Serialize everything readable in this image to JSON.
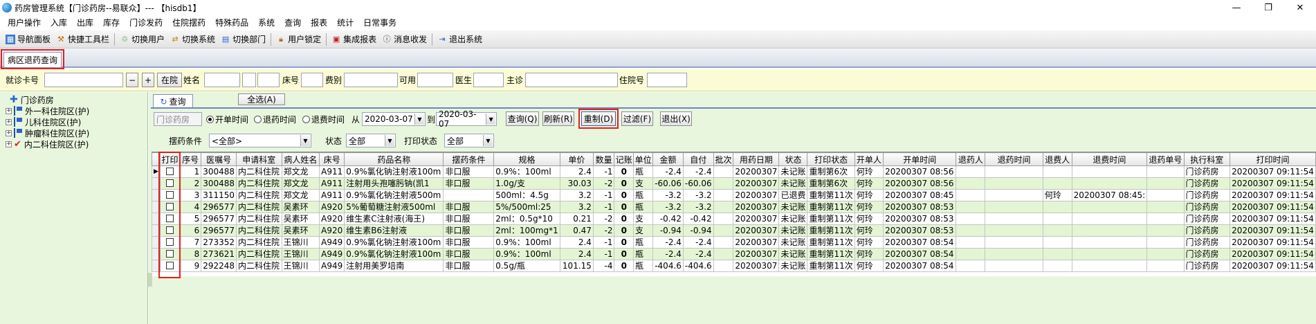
{
  "window": {
    "title": "药房管理系统【门诊药房--易联众】--- 【hisdb1】",
    "controls": [
      "—",
      "❐",
      "✕"
    ]
  },
  "menu": [
    "用户操作",
    "入库",
    "出库",
    "库存",
    "门诊发药",
    "住院摆药",
    "特殊药品",
    "系统",
    "查询",
    "报表",
    "统计",
    "日常事务"
  ],
  "toolbar": [
    {
      "label": "导航面板",
      "icon": "nav-panel-icon"
    },
    {
      "label": "快捷工具栏",
      "icon": "quick-toolbar-icon"
    },
    {
      "label": "切换用户",
      "icon": "switch-user-icon"
    },
    {
      "label": "切换系统",
      "icon": "switch-system-icon"
    },
    {
      "label": "切换部门",
      "icon": "switch-dept-icon"
    },
    {
      "label": "用户锁定",
      "icon": "user-lock-icon"
    },
    {
      "label": "集成报表",
      "icon": "report-icon"
    },
    {
      "label": "消息收发",
      "icon": "message-icon"
    },
    {
      "label": "退出系统",
      "icon": "exit-icon"
    }
  ],
  "tab": {
    "label": "病区退药查询"
  },
  "filter": {
    "card_label": "就诊卡号",
    "card_value": "",
    "minus": "−",
    "plus": "+",
    "status_btn": "在院",
    "name_label": "姓名",
    "bed_label": "床号",
    "fee_label": "费别",
    "usable_label": "可用",
    "doctor_label": "医生",
    "main_label": "主诊",
    "inpatient_label": "住院号"
  },
  "tree": [
    {
      "label": "门诊药房",
      "type": "root"
    },
    {
      "label": "外一科住院区(护)",
      "type": "ward"
    },
    {
      "label": "儿科住院区(护)",
      "type": "ward"
    },
    {
      "label": "肿瘤科住院区(护)",
      "type": "ward"
    },
    {
      "label": "内二科住院区(护)",
      "type": "checked"
    }
  ],
  "query": {
    "tab_label": "查询",
    "select_all": "全选(A)",
    "pharmacy_field": "门诊药房",
    "radio_open": "开单时间",
    "radio_return": "退药时间",
    "radio_refund": "退费时间",
    "from_label": "从",
    "from_date": "2020-03-07",
    "to_label": "到",
    "to_date": "2020-03-07",
    "btn_query": "查询(Q)",
    "btn_refresh": "刷新(R)",
    "btn_reprint": "重制(D)",
    "btn_filter": "过滤(F)",
    "btn_exit": "退出(X)",
    "cond_label": "摆药条件",
    "cond_value": "<全部>",
    "status_label": "状态",
    "status_value": "全部",
    "print_label": "打印状态",
    "print_value": "全部"
  },
  "table": {
    "columns": [
      "打印",
      "序号",
      "医嘱号",
      "申请科室",
      "病人姓名",
      "床号",
      "药品名称",
      "摆药条件",
      "规格",
      "单价",
      "数量",
      "记账",
      "单位",
      "金额",
      "自付",
      "批次",
      "用药日期",
      "状态",
      "打印状态",
      "开单人",
      "开单时间",
      "退药人",
      "退药时间",
      "退费人",
      "退费时间",
      "退药单号",
      "执行科室",
      "打印时间"
    ],
    "rows": [
      [
        "1",
        "300488",
        "内二科住院",
        "郑文龙",
        "A911",
        "0.9%氯化钠注射液100m",
        "非口服",
        "0.9%：100ml",
        "2.4",
        "-1",
        "0",
        "瓶",
        "-2.4",
        "-2.4",
        "",
        "20200307",
        "未记账",
        "重制第6次",
        "何玲",
        "20200307 08:56",
        "",
        "",
        "",
        "",
        "",
        "门诊药房",
        "20200307 09:11:54"
      ],
      [
        "2",
        "300488",
        "内二科住院",
        "郑文龙",
        "A911",
        "注射用头孢噻肟钠(凯1",
        "非口服",
        "1.0g/支",
        "30.03",
        "-2",
        "0",
        "支",
        "-60.06",
        "-60.06",
        "",
        "20200307",
        "未记账",
        "重制第6次",
        "何玲",
        "20200307 08:56",
        "",
        "",
        "",
        "",
        "",
        "门诊药房",
        "20200307 09:11:54"
      ],
      [
        "3",
        "311150",
        "内二科住院",
        "郑文龙",
        "A911",
        "0.9%氯化钠注射液500m",
        "",
        "500ml：4.5g",
        "3.2",
        "-1",
        "0",
        "瓶",
        "-3.2",
        "-3.2",
        "",
        "20200307",
        "已退费",
        "重制第11次",
        "何玲",
        "20200307 08:45",
        "",
        "",
        "何玲",
        "20200307 08:45:",
        "",
        "门诊药房",
        "20200307 09:11:54"
      ],
      [
        "4",
        "296577",
        "内二科住院",
        "吴素环",
        "A920",
        "5%葡萄糖注射液500ml",
        "非口服",
        "5%/500ml:25",
        "3.2",
        "-1",
        "0",
        "瓶",
        "-3.2",
        "-3.2",
        "",
        "20200307",
        "未记账",
        "重制第11次",
        "何玲",
        "20200307 08:53",
        "",
        "",
        "",
        "",
        "",
        "门诊药房",
        "20200307 09:11:54"
      ],
      [
        "5",
        "296577",
        "内二科住院",
        "吴素环",
        "A920",
        "维生素C注射液(海王)",
        "非口服",
        "2ml：0.5g*10",
        "0.21",
        "-2",
        "0",
        "支",
        "-0.42",
        "-0.42",
        "",
        "20200307",
        "未记账",
        "重制第11次",
        "何玲",
        "20200307 08:53",
        "",
        "",
        "",
        "",
        "",
        "门诊药房",
        "20200307 09:11:54"
      ],
      [
        "6",
        "296577",
        "内二科住院",
        "吴素环",
        "A920",
        "维生素B6注射液",
        "非口服",
        "2ml：100mg*1",
        "0.47",
        "-2",
        "0",
        "支",
        "-0.94",
        "-0.94",
        "",
        "20200307",
        "未记账",
        "重制第11次",
        "何玲",
        "20200307 08:53",
        "",
        "",
        "",
        "",
        "",
        "门诊药房",
        "20200307 09:11:54"
      ],
      [
        "7",
        "273352",
        "内二科住院",
        "王锦川",
        "A949",
        "0.9%氯化钠注射液100m",
        "非口服",
        "0.9%：100ml",
        "2.4",
        "-1",
        "0",
        "瓶",
        "-2.4",
        "-2.4",
        "",
        "20200307",
        "未记账",
        "重制第11次",
        "何玲",
        "20200307 08:54",
        "",
        "",
        "",
        "",
        "",
        "门诊药房",
        "20200307 09:11:54"
      ],
      [
        "8",
        "273621",
        "内二科住院",
        "王锦川",
        "A949",
        "0.9%氯化钠注射液100m",
        "非口服",
        "0.9%：100ml",
        "2.4",
        "-1",
        "0",
        "瓶",
        "-2.4",
        "-2.4",
        "",
        "20200307",
        "未记账",
        "重制第11次",
        "何玲",
        "20200307 08:54",
        "",
        "",
        "",
        "",
        "",
        "门诊药房",
        "20200307 09:11:54"
      ],
      [
        "9",
        "292248",
        "内二科住院",
        "王锦川",
        "A949",
        "注射用美罗培南",
        "非口服",
        "0.5g/瓶",
        "101.15",
        "-4",
        "0",
        "瓶",
        "-404.6",
        "-404.6",
        "",
        "20200307",
        "未记账",
        "重制第11次",
        "何玲",
        "20200307 08:54",
        "",
        "",
        "",
        "",
        "",
        "门诊药房",
        "20200307 09:11:54"
      ]
    ]
  },
  "colors": {
    "highlight": "#e02020",
    "row_alt": "#e4f5d4",
    "filter_bg": "#fbfbd6",
    "panel_bg": "#e9f6de"
  }
}
